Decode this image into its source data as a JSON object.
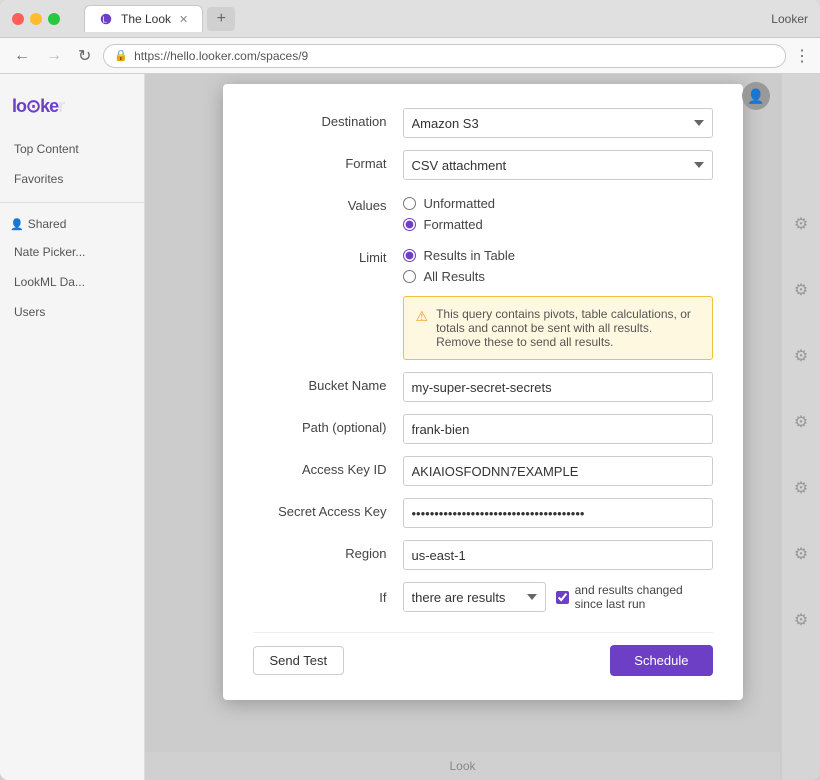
{
  "browser": {
    "tab_title": "The Look",
    "url": "https://hello.looker.com/spaces/9",
    "menu_label": "Looker"
  },
  "sidebar": {
    "logo": "looker",
    "items": [
      {
        "label": "Top Content"
      },
      {
        "label": "Favorites"
      },
      {
        "label": "Shared"
      },
      {
        "label": "Nate Picker..."
      },
      {
        "label": "LookML Da..."
      },
      {
        "label": "Users"
      }
    ]
  },
  "dialog": {
    "destination_label": "Destination",
    "destination_value": "Amazon S3",
    "format_label": "Format",
    "format_value": "CSV attachment",
    "values_label": "Values",
    "values_unformatted": "Unformatted",
    "values_formatted": "Formatted",
    "limit_label": "Limit",
    "limit_results_in_table": "Results in Table",
    "limit_all_results": "All Results",
    "warning_text": "This query contains pivots, table calculations, or totals and cannot be sent with all results. Remove these to send all results.",
    "bucket_name_label": "Bucket Name",
    "bucket_name_value": "my-super-secret-secrets",
    "path_label": "Path (optional)",
    "path_value": "frank-bien",
    "access_key_id_label": "Access Key ID",
    "access_key_id_value": "AKIAIOSFODNN7EXAMPLE",
    "secret_access_key_label": "Secret Access Key",
    "secret_access_key_value": "••••••••••••••••••••••••••••••••••••••",
    "region_label": "Region",
    "region_value": "us-east-1",
    "if_label": "If",
    "if_value": "there are results",
    "if_checkbox_label": "and results changed since last run",
    "send_test_label": "Send Test",
    "schedule_label": "Schedule"
  }
}
